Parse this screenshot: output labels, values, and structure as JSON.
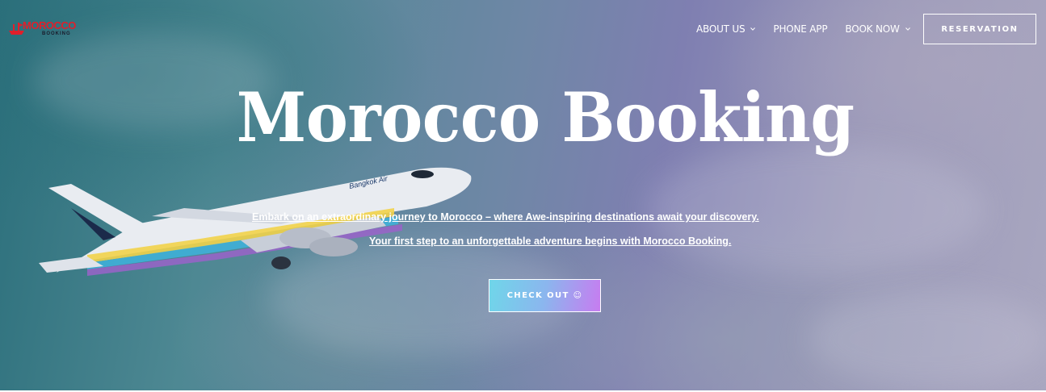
{
  "header": {
    "logo": {
      "name": "MOROCCO",
      "sub": "BOOKING"
    },
    "nav": [
      {
        "label": "ABOUT US",
        "has_dropdown": true
      },
      {
        "label": "PHONE APP",
        "has_dropdown": false
      },
      {
        "label": "BOOK NOW",
        "has_dropdown": true
      }
    ],
    "reservation_label": "RESERVATION"
  },
  "hero": {
    "title": "Morocco Booking",
    "line1": "Embark on an extraordinary journey to Morocco – where Awe-inspiring destinations await your discovery.",
    "line2": "Your first step to an unforgettable adventure begins with Morocco Booking.",
    "cta_label": "CHECK OUT ☺",
    "aircraft_text": "Bangkok Air"
  },
  "colors": {
    "logo_red": "#e01f2b",
    "cta_gradient_start": "#6fd6e9",
    "cta_gradient_end": "#c77cf0"
  }
}
